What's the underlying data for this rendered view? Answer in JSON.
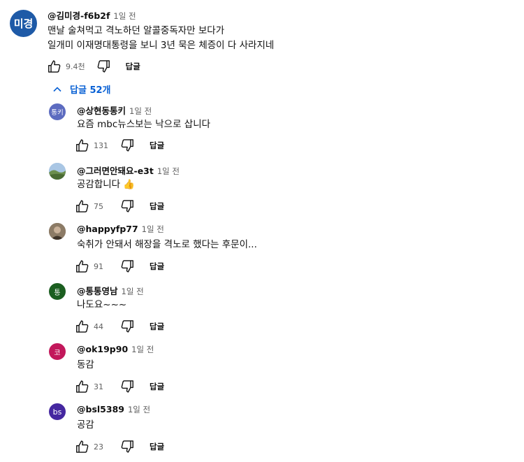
{
  "top": {
    "avatar_text": "미경",
    "avatar_color": "#1e5aa7",
    "author": "@김미경-f6b2f",
    "time": "1일 전",
    "line1": "맨날 술쳐먹고  격노하던 알콜중독자만 보다가",
    "line2": "일개미 이재명대통령을 보니  3년 묵은 체증이 다 사라지네",
    "likes": "9.4천",
    "reply_label": "답글"
  },
  "replies_toggle": {
    "label": "답글 52개",
    "color": "#065fd4"
  },
  "replies": [
    {
      "avatar_text": "통키",
      "avatar_color": "#5c6bc0",
      "author": "@상현동통키",
      "time": "1일 전",
      "text": "요즘 mbc뉴스보는 낙으로 삽니다",
      "likes": "131",
      "reply_label": "답글"
    },
    {
      "avatar_text": "",
      "avatar_kind": "landscape-photo",
      "author": "@그러면안돼요-e3t",
      "time": "1일 전",
      "text": "공감합니다 👍",
      "likes": "75",
      "reply_label": "답글"
    },
    {
      "avatar_text": "",
      "avatar_kind": "portrait-photo",
      "author": "@happyfp77",
      "time": "1일 전",
      "text": "숙취가 안돼서 해장을 격노로 했다는 후문이...",
      "likes": "91",
      "reply_label": "답글"
    },
    {
      "avatar_text": "통",
      "avatar_color": "#1b5e20",
      "author": "@통통영남",
      "time": "1일 전",
      "text": "나도요~~~",
      "likes": "44",
      "reply_label": "답글"
    },
    {
      "avatar_text": "코",
      "avatar_color": "#c2185b",
      "author": "@ok19p90",
      "time": "1일 전",
      "text": "동감",
      "likes": "31",
      "reply_label": "답글"
    },
    {
      "avatar_text": "bs",
      "avatar_color": "#4527a0",
      "author": "@bsl5389",
      "time": "1일 전",
      "text": "공감",
      "likes": "23",
      "reply_label": "답글"
    }
  ]
}
